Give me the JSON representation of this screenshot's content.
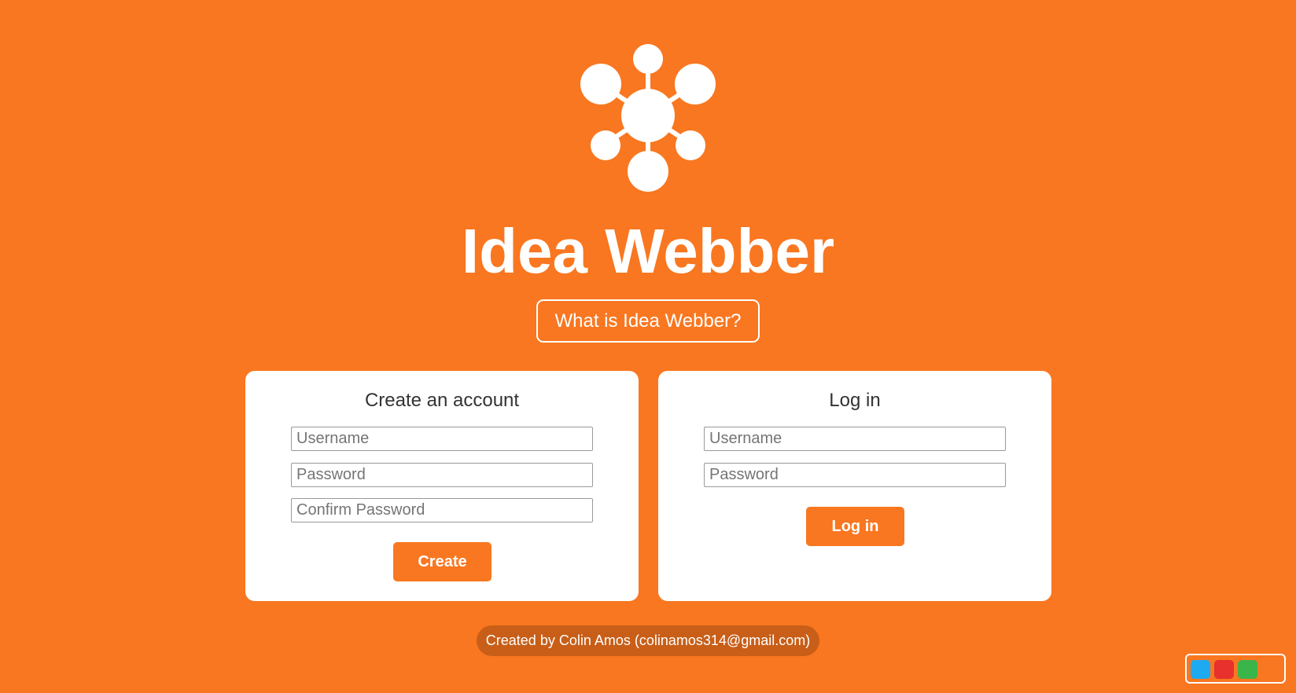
{
  "app": {
    "title": "Idea Webber",
    "logo_icon": "network-nodes-icon"
  },
  "about_button": {
    "label": "What is Idea Webber?"
  },
  "create_account": {
    "heading": "Create an account",
    "username_placeholder": "Username",
    "username_value": "",
    "password_placeholder": "Password",
    "password_value": "",
    "confirm_placeholder": "Confirm Password",
    "confirm_value": "",
    "button_label": "Create"
  },
  "login": {
    "heading": "Log in",
    "username_placeholder": "Username",
    "username_value": "",
    "password_placeholder": "Password",
    "password_value": "",
    "button_label": "Log in"
  },
  "footer": {
    "text": "Created by Colin Amos (colinamos314@gmail.com)"
  },
  "colors": {
    "accent": "#f97720",
    "footer_bg": "#c85e18",
    "card_bg": "#ffffff",
    "theme_swatches": [
      "#1eaaf1",
      "#e8302c",
      "#3ab54a"
    ]
  }
}
